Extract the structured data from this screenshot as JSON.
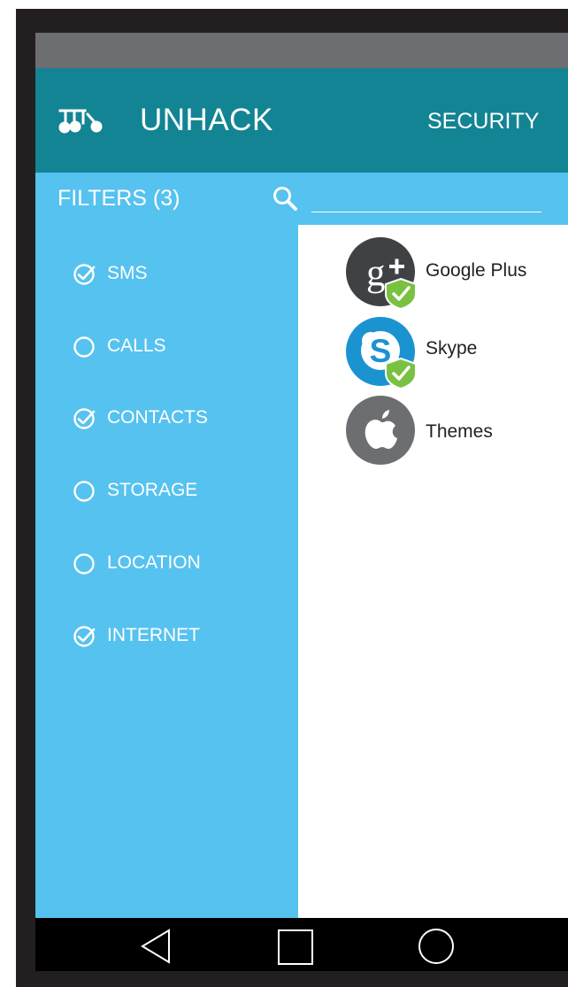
{
  "app": {
    "title": "UNHACK",
    "tab": "SECURITY"
  },
  "filters": {
    "title": "FILTERS (3)",
    "search": {
      "value": "",
      "placeholder": ""
    },
    "items": [
      {
        "label": "SMS",
        "checked": true
      },
      {
        "label": "CALLS",
        "checked": false
      },
      {
        "label": "CONTACTS",
        "checked": true
      },
      {
        "label": "STORAGE",
        "checked": false
      },
      {
        "label": "LOCATION",
        "checked": false
      },
      {
        "label": "INTERNET",
        "checked": true
      }
    ]
  },
  "apps": [
    {
      "name": "Google Plus",
      "icon": "google-plus-icon",
      "verified": true
    },
    {
      "name": "Skype",
      "icon": "skype-icon",
      "verified": true
    },
    {
      "name": "Themes",
      "icon": "apple-icon",
      "verified": false
    }
  ],
  "colors": {
    "app_bar": "#138493",
    "filter_panel": "#56C2EF",
    "status_bar": "#6D6E71",
    "device_frame": "#231F20",
    "verified_badge": "#7AC142"
  },
  "navigation": {
    "back": "back-icon",
    "home": "home-icon",
    "recents": "recents-icon"
  }
}
